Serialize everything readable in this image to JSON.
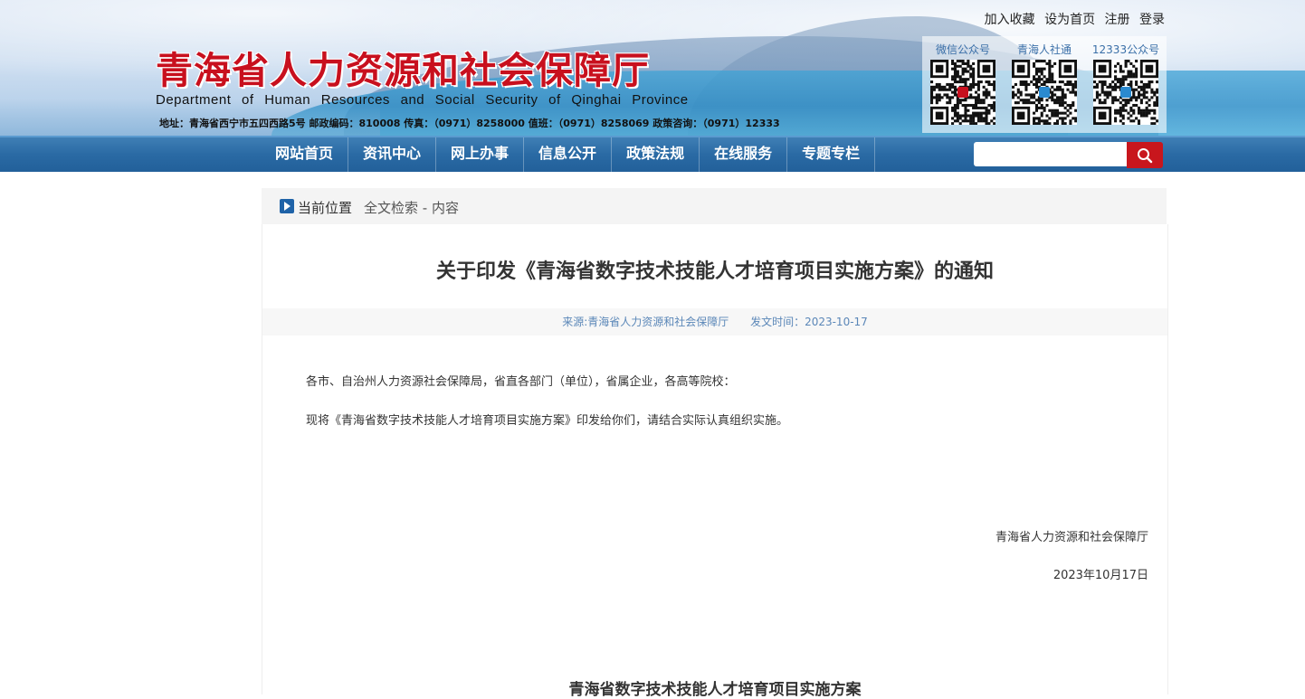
{
  "header": {
    "title": "青海省人力资源和社会保障厅",
    "subtitle": "Department of Human Resources and Social Security of Qinghai Province",
    "address": "地址：青海省西宁市五四西路5号 邮政编码：810008 传真：（0971）8258000 值班：（0971）8258069 政策咨询：（0971）12333",
    "top_links": [
      "加入收藏",
      "设为首页",
      "注册",
      "登录"
    ],
    "qr_codes": [
      {
        "label": "微信公众号",
        "icon": "wechat-qr-icon"
      },
      {
        "label": "青海人社通",
        "icon": "app-qr-icon"
      },
      {
        "label": "12333公众号",
        "icon": "hotline-qr-icon"
      }
    ]
  },
  "nav": {
    "items": [
      "网站首页",
      "资讯中心",
      "网上办事",
      "信息公开",
      "政策法规",
      "在线服务",
      "专题专栏"
    ],
    "search": {
      "placeholder": "",
      "button_icon": "search-icon"
    }
  },
  "breadcrumb": {
    "label": "当前位置",
    "path": "全文检索 - 内容"
  },
  "article": {
    "title": "关于印发《青海省数字技术技能人才培育项目实施方案》的通知",
    "source": "来源:青海省人力资源和社会保障厅",
    "date": "发文时间：2023-10-17",
    "paragraphs": [
      "各市、自治州人力资源社会保障局，省直各部门（单位），省属企业，各高等院校：",
      "现将《青海省数字技术技能人才培育项目实施方案》印发给你们，请结合实际认真组织实施。"
    ],
    "signature_org": "青海省人力资源和社会保障厅",
    "signature_date": "2023年10月17日",
    "attachment_title": "青海省数字技术技能人才培育项目实施方案"
  },
  "colors": {
    "title_red": "#c8101e",
    "nav_blue": "#2a6aa4",
    "search_red": "#c8161d",
    "meta_blue": "#5b87b8"
  }
}
